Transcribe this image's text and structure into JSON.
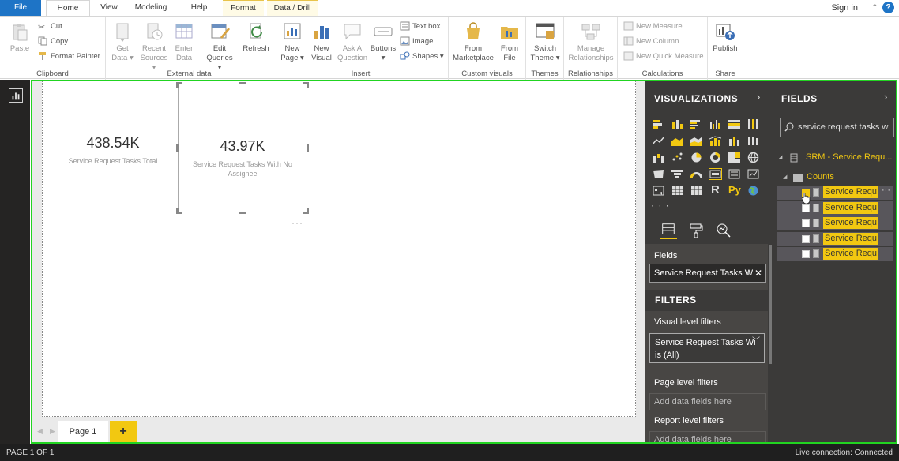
{
  "ribbon_tabs": [
    "File",
    "Home",
    "View",
    "Modeling",
    "Help",
    "Format",
    "Data / Drill"
  ],
  "account": {
    "signin": "Sign in",
    "help": "?"
  },
  "clipboard": {
    "paste": "Paste",
    "cut": "Cut",
    "copy": "Copy",
    "format_painter": "Format Painter",
    "label": "Clipboard"
  },
  "external_data": {
    "get_data": [
      "Get",
      "Data ▾"
    ],
    "recent_sources": [
      "Recent",
      "Sources ▾"
    ],
    "enter_data": [
      "Enter",
      "Data"
    ],
    "edit_queries": [
      "Edit",
      "Queries ▾"
    ],
    "refresh": "Refresh",
    "label": "External data"
  },
  "insert": {
    "new_page": [
      "New",
      "Page ▾"
    ],
    "new_visual": [
      "New",
      "Visual"
    ],
    "ask_question": [
      "Ask A",
      "Question"
    ],
    "buttons": [
      "Buttons",
      "▾"
    ],
    "text_box": "Text box",
    "image": "Image",
    "shapes": "Shapes ▾",
    "label": "Insert"
  },
  "custom_visuals": {
    "from_marketplace": [
      "From",
      "Marketplace"
    ],
    "from_file": [
      "From",
      "File"
    ],
    "label": "Custom visuals"
  },
  "themes": {
    "switch_theme": [
      "Switch",
      "Theme ▾"
    ],
    "label": "Themes"
  },
  "relationships": {
    "manage": [
      "Manage",
      "Relationships"
    ],
    "label": "Relationships"
  },
  "calculations": {
    "new_measure": "New Measure",
    "new_column": "New Column",
    "new_quick_measure": "New Quick Measure",
    "label": "Calculations"
  },
  "share": {
    "publish": "Publish",
    "label": "Share"
  },
  "cards": [
    {
      "value": "438.54K",
      "label": "Service Request Tasks Total"
    },
    {
      "value": "43.97K",
      "label": "Service Request Tasks With No Assignee"
    }
  ],
  "page_tabs": {
    "page1": "Page 1",
    "add": "+"
  },
  "visualizations": {
    "title": "VISUALIZATIONS",
    "more": "· · ·",
    "fields_label": "Fields",
    "field_well_value": "Service Request Tasks W",
    "r_visual": "R",
    "py_visual": "Py"
  },
  "filters": {
    "title": "FILTERS",
    "visual_level": "Visual level filters",
    "visual_filter_name": "Service Request Tasks Wi",
    "visual_filter_value": "is (All)",
    "page_level": "Page level filters",
    "page_drop": "Add data fields here",
    "report_level": "Report level filters",
    "report_drop": "Add data fields here"
  },
  "fields": {
    "title": "FIELDS",
    "search_value": "service request tasks w",
    "table_name": "SRM - Service Requ...",
    "folder_name": "Counts",
    "items": [
      {
        "name": "Service Requ",
        "checked": true
      },
      {
        "name": "Service Requ",
        "checked": false
      },
      {
        "name": "Service Requ",
        "checked": false
      },
      {
        "name": "Service Requ",
        "checked": false
      },
      {
        "name": "Service Requ",
        "checked": false
      }
    ]
  },
  "status": {
    "page": "PAGE 1 OF 1",
    "connection": "Live connection: Connected"
  },
  "colors": {
    "accent_yellow": "#f2c811",
    "highlight_green": "#21d421",
    "file_blue": "#1e74c6",
    "pane_dark": "#3b3a39"
  }
}
